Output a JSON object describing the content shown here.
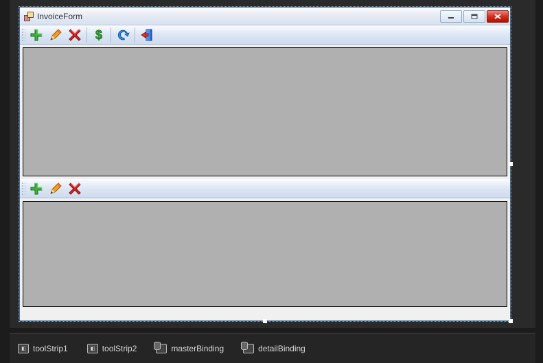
{
  "window": {
    "title": "InvoiceForm"
  },
  "toolstrip1": {
    "buttons": [
      "add",
      "edit",
      "delete",
      "money",
      "refresh",
      "exit"
    ]
  },
  "toolstrip2": {
    "buttons": [
      "add",
      "edit",
      "delete"
    ]
  },
  "tray": {
    "items": [
      {
        "name": "toolStrip1",
        "icon": "toolstrip"
      },
      {
        "name": "toolStrip2",
        "icon": "toolstrip"
      },
      {
        "name": "masterBinding",
        "icon": "binding"
      },
      {
        "name": "detailBinding",
        "icon": "binding"
      }
    ]
  }
}
